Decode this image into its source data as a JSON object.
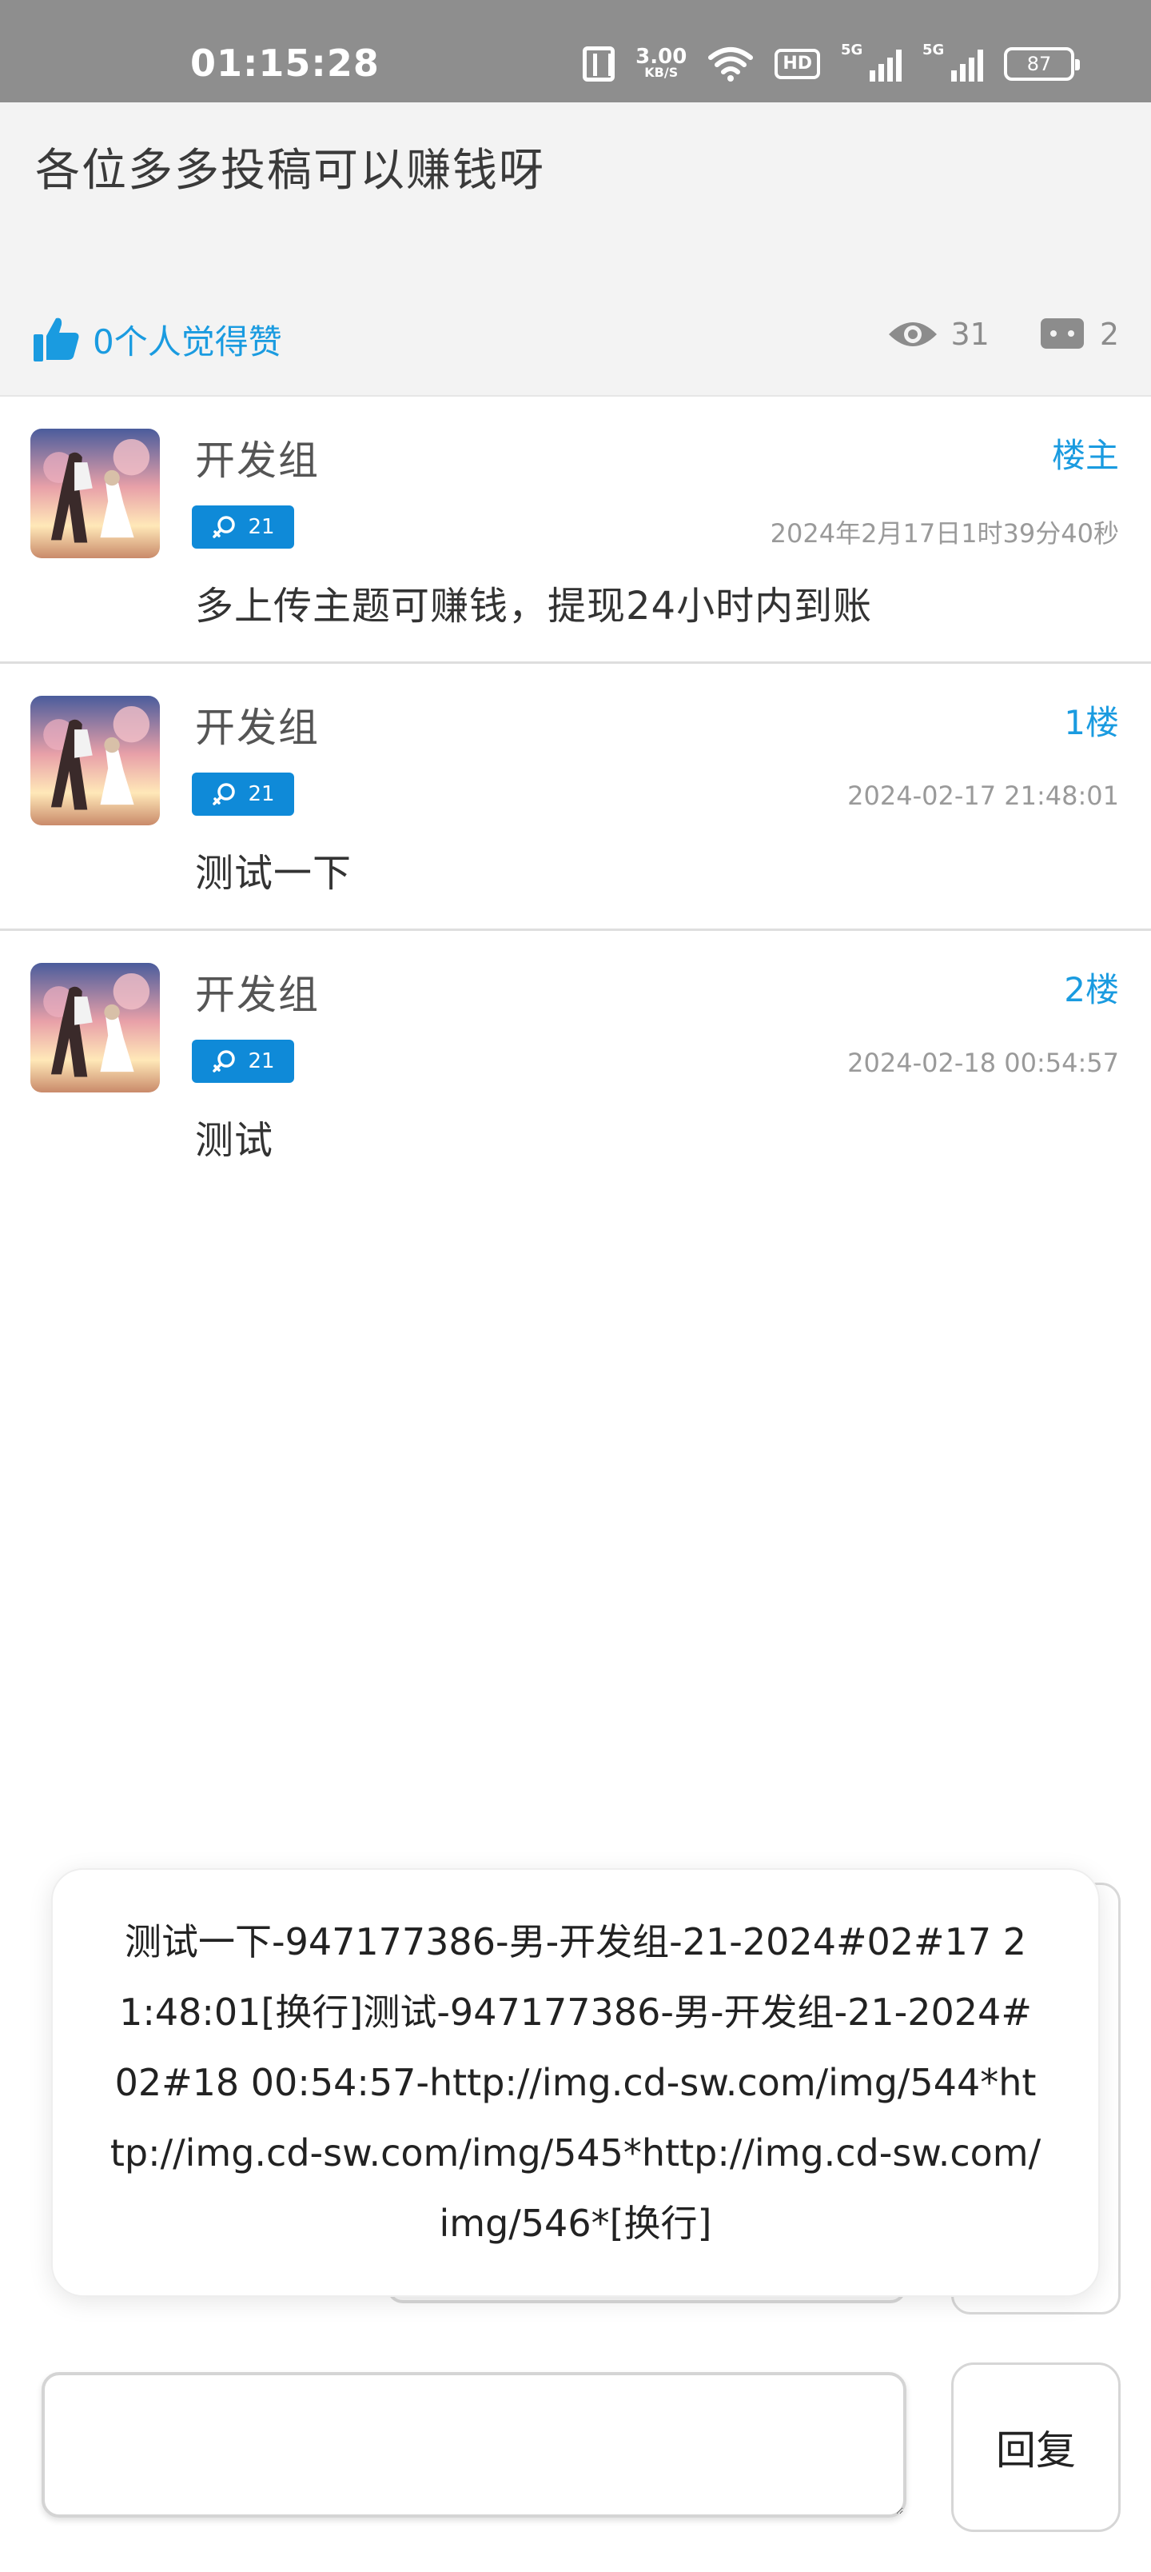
{
  "status_bar": {
    "time": "01:15:28",
    "speed_value": "3.00",
    "speed_unit": "KB/S",
    "hd_label": "HD",
    "sim1_label": "5G",
    "sim2_label": "5G",
    "battery": "87",
    "icons": [
      "nfc-icon",
      "wifi-icon",
      "signal-icon",
      "battery-icon"
    ]
  },
  "topic": {
    "title": "各位多多投稿可以赚钱呀",
    "likes_text": "0个人觉得赞",
    "views": "31",
    "comments": "2",
    "accent_color": "#1a9be0"
  },
  "posts": [
    {
      "name": "开发组",
      "floor": "楼主",
      "level": "21",
      "time": "2024年2月17日1时39分40秒",
      "content": "多上传主题可赚钱，提现24小时内到账"
    },
    {
      "name": "开发组",
      "floor": "1楼",
      "level": "21",
      "time": "2024-02-17 21:48:01",
      "content": "测试一下"
    },
    {
      "name": "开发组",
      "floor": "2楼",
      "level": "21",
      "time": "2024-02-18 00:54:57",
      "content": "测试"
    }
  ],
  "popup": {
    "text": "测试一下-947177386-男-开发组-21-2024#02#17 21:48:01[换行]测试-947177386-男-开发组-21-2024#02#18 00:54:57-http://img.cd-sw.com/img/544*http://img.cd-sw.com/img/545*http://img.cd-sw.com/img/546*[换行]"
  },
  "reply": {
    "input_value": "",
    "button_label": "回复"
  }
}
